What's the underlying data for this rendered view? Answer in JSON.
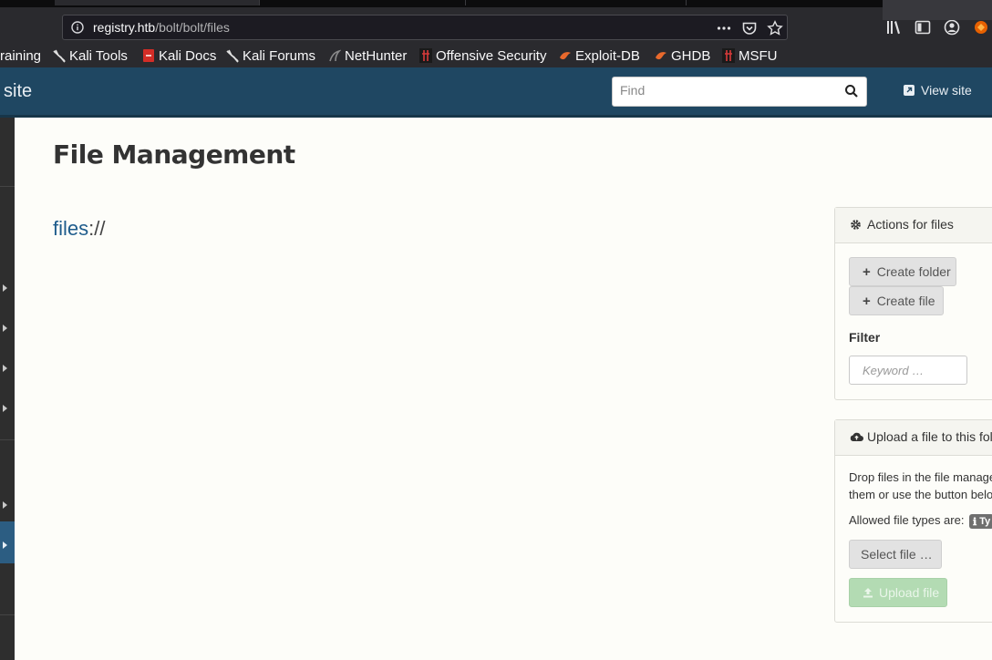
{
  "browser": {
    "url_host": "registry.htb",
    "url_path": "/bolt/bolt/files",
    "bookmarks": [
      {
        "label": "raining",
        "icon": "none"
      },
      {
        "label": "Kali Tools",
        "icon": "kali-dragon-icon"
      },
      {
        "label": "Kali Docs",
        "icon": "kali-docs-icon"
      },
      {
        "label": "Kali Forums",
        "icon": "kali-dragon-icon"
      },
      {
        "label": "NetHunter",
        "icon": "nethunter-icon"
      },
      {
        "label": "Offensive Security",
        "icon": "offsec-icon"
      },
      {
        "label": "Exploit-DB",
        "icon": "exploitdb-icon"
      },
      {
        "label": "GHDB",
        "icon": "ghdb-icon"
      },
      {
        "label": "MSFU",
        "icon": "offsec-icon"
      }
    ]
  },
  "header": {
    "site_label": "site",
    "search_placeholder": "Find",
    "view_site_label": "View site"
  },
  "main": {
    "title": "File Management",
    "path_link": "files",
    "path_suffix": "://"
  },
  "actions_panel": {
    "title": "Actions for files",
    "create_folder": "Create folder",
    "create_file": "Create file",
    "filter_label": "Filter",
    "keyword_placeholder": "Keyword …"
  },
  "upload_panel": {
    "title": "Upload a file to this folde",
    "line1": "Drop files in the file manage",
    "line2": "them or use the button belo",
    "allowed_label": "Allowed file types are:",
    "allowed_badge": "Ty",
    "select_file": "Select file …",
    "upload_file": "Upload file"
  },
  "colors": {
    "header_bg": "#1f4762",
    "link": "#1e5c8c",
    "sidebar_active": "#2c5d82",
    "upload_button": "#b3dbb3"
  }
}
